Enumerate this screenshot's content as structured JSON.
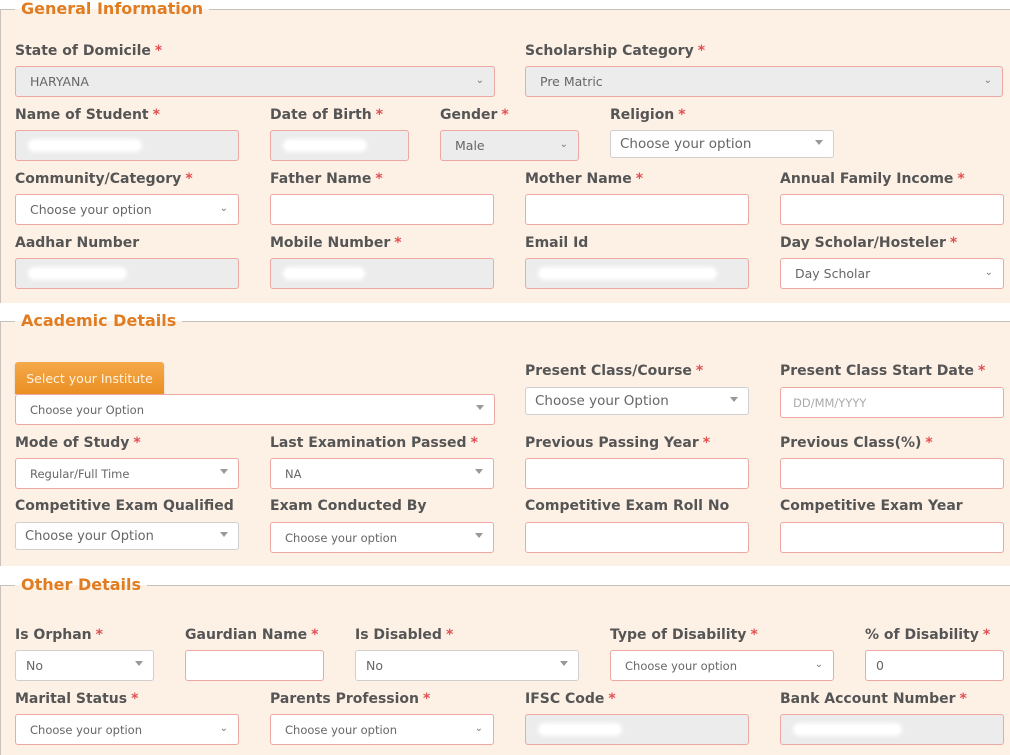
{
  "sections": {
    "general": "General Information",
    "academic": "Academic Details",
    "other": "Other Details"
  },
  "required_marker": "*",
  "general": {
    "state_of_domicile": {
      "label": "State of Domicile",
      "value": "HARYANA"
    },
    "scholarship_category": {
      "label": "Scholarship Category",
      "value": "Pre Matric"
    },
    "name_of_student": {
      "label": "Name of Student",
      "value": "[redacted]"
    },
    "date_of_birth": {
      "label": "Date of Birth",
      "value": "[redacted]"
    },
    "gender": {
      "label": "Gender",
      "value": "Male"
    },
    "religion": {
      "label": "Religion",
      "value": "Choose your option"
    },
    "community_category": {
      "label": "Community/Category",
      "value": "Choose your option"
    },
    "father_name": {
      "label": "Father Name",
      "value": ""
    },
    "mother_name": {
      "label": "Mother Name",
      "value": ""
    },
    "annual_family_income": {
      "label": "Annual Family Income",
      "value": ""
    },
    "aadhar_number": {
      "label": "Aadhar Number",
      "value": "[redacted]"
    },
    "mobile_number": {
      "label": "Mobile Number",
      "value": "[redacted]"
    },
    "email_id": {
      "label": "Email Id",
      "value": "[redacted]"
    },
    "day_scholar_hosteler": {
      "label": "Day Scholar/Hosteler",
      "value": "Day Scholar"
    }
  },
  "academic": {
    "select_institute_button": "Select your Institute",
    "institute": {
      "value": "Choose your Option"
    },
    "present_class_course": {
      "label": "Present Class/Course",
      "value": "Choose your Option"
    },
    "present_class_start_date": {
      "label": "Present Class Start Date",
      "placeholder": "DD/MM/YYYY"
    },
    "mode_of_study": {
      "label": "Mode of Study",
      "value": "Regular/Full Time"
    },
    "last_examination_passed": {
      "label": "Last Examination Passed",
      "value": "NA"
    },
    "previous_passing_year": {
      "label": "Previous Passing Year",
      "value": ""
    },
    "previous_class_percent": {
      "label": "Previous Class(%)",
      "value": ""
    },
    "competitive_exam_qualified": {
      "label": "Competitive Exam Qualified",
      "value": "Choose your Option"
    },
    "exam_conducted_by": {
      "label": "Exam Conducted By",
      "value": "Choose your option"
    },
    "competitive_exam_roll_no": {
      "label": "Competitive Exam Roll No",
      "value": ""
    },
    "competitive_exam_year": {
      "label": "Competitive Exam Year",
      "value": ""
    }
  },
  "other": {
    "is_orphan": {
      "label": "Is Orphan",
      "value": "No"
    },
    "guardian_name": {
      "label": "Gaurdian Name",
      "value": ""
    },
    "is_disabled": {
      "label": "Is Disabled",
      "value": "No"
    },
    "type_of_disability": {
      "label": "Type of Disability",
      "value": "Choose your option"
    },
    "percent_of_disability": {
      "label": "% of Disability",
      "value": "0"
    },
    "marital_status": {
      "label": "Marital Status",
      "value": "Choose your option"
    },
    "parents_profession": {
      "label": "Parents Profession",
      "value": "Choose your option"
    },
    "ifsc_code": {
      "label": "IFSC Code",
      "value": "[redacted]"
    },
    "bank_account_number": {
      "label": "Bank Account Number",
      "value": "[redacted]"
    }
  },
  "colors": {
    "accent": "#e07d22",
    "section_bg": "#fdf1e6",
    "required": "#e05050",
    "field_border": "#eda8a3"
  }
}
